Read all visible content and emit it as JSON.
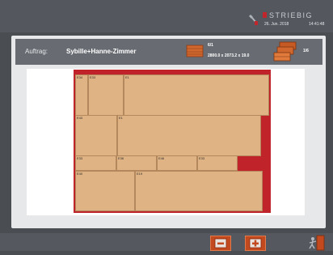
{
  "topbar": {
    "brand": "STRIEBIG",
    "date": "26. Jun. 2018",
    "time": "14:41:48",
    "tool_icon": "wrench-icon"
  },
  "header": {
    "auftrag_label": "Auftrag:",
    "auftrag_name": "Sybille+Hanne-Zimmer",
    "plate_count": "6/1",
    "plate_dimensions": "2800.0 x 2073.2 x 19.0",
    "stack_count": "1/6"
  },
  "board": {
    "color": "#c1232b",
    "parts": [
      {
        "label": "E34"
      },
      {
        "label": "E33"
      },
      {
        "label": "E1"
      },
      {
        "label": "E43"
      },
      {
        "label": "E1"
      },
      {
        "label": "E33"
      },
      {
        "label": "E36"
      },
      {
        "label": "E46"
      },
      {
        "label": "E33"
      },
      {
        "label": "E40"
      },
      {
        "label": "E19"
      }
    ]
  },
  "bottombar": {
    "zoom_out_icon": "minus-icon",
    "zoom_in_icon": "plus-icon",
    "exit_icon": "exit-door-icon"
  },
  "colors": {
    "accent": "#c24a1e",
    "part_fill": "#dfb383",
    "background": "#4a4d52"
  }
}
